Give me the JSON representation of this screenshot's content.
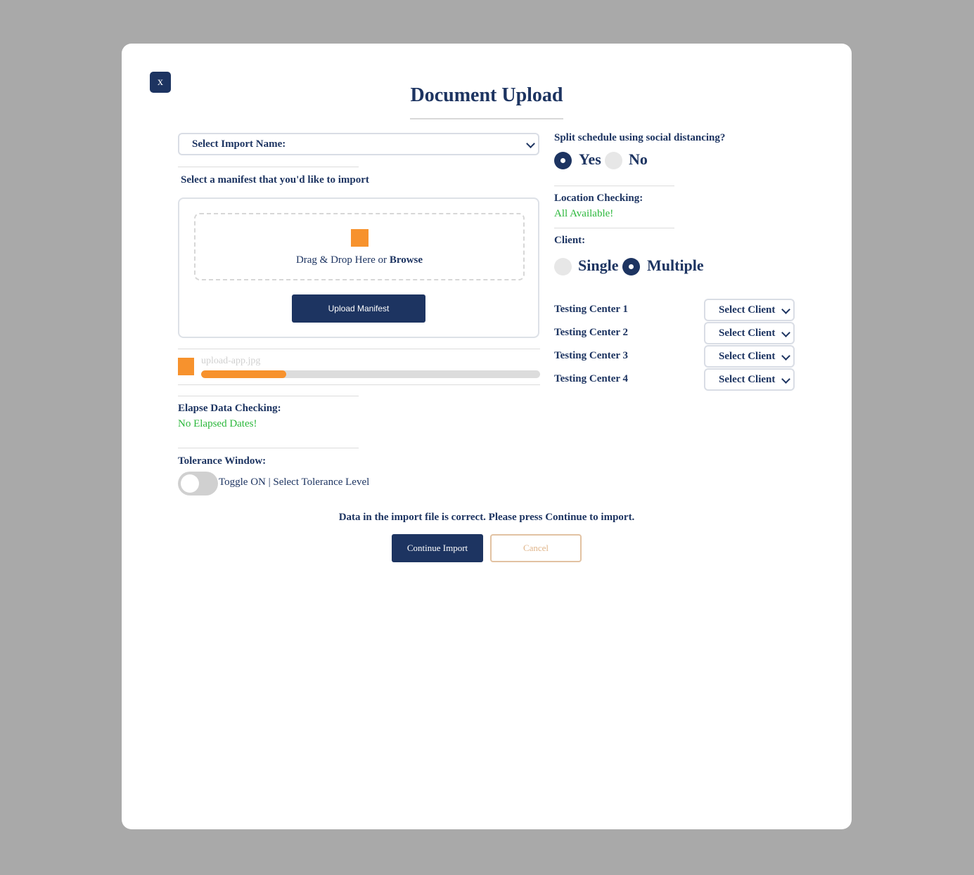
{
  "modal": {
    "close_label": "x",
    "title": "Document Upload"
  },
  "import": {
    "select_value": "Select Import Name:",
    "subtitle": "Select a manifest that you'd like to import",
    "drop_text": "Drag & Drop Here or",
    "browse_label": "Browse",
    "upload_button": "Upload Manifest",
    "file_name": "upload-app.jpg",
    "progress": 0.25
  },
  "elapse": {
    "label": "Elapse Data Checking:",
    "status": "No Elapsed Dates!"
  },
  "tolerance": {
    "label": "Tolerance Window:",
    "toggle_text": "Toggle ON | Select Tolerance Level",
    "toggle_on": false
  },
  "split": {
    "question": "Split schedule using social distancing?",
    "yes_label": "Yes",
    "no_label": "No",
    "selected": "Yes"
  },
  "location": {
    "label": "Location Checking:",
    "status": "All Available!"
  },
  "client": {
    "label": "Client:",
    "single_label": "Single",
    "multiple_label": "Multiple",
    "selected": "Multiple"
  },
  "testing_centers": [
    {
      "label": "Testing Center 1",
      "select_value": "Select Client"
    },
    {
      "label": "Testing Center 2",
      "select_value": "Select Client"
    },
    {
      "label": "Testing Center 3",
      "select_value": "Select Client"
    },
    {
      "label": "Testing Center 4",
      "select_value": "Select Client"
    }
  ],
  "footer": {
    "message": "Data in the import file is correct. Please press Continue to import.",
    "continue_label": "Continue Import",
    "cancel_label": "Cancel"
  },
  "colors": {
    "primary": "#1d3461",
    "accent": "#f7922d",
    "success": "#2ab73a",
    "backdrop": "#a9a9a9"
  }
}
